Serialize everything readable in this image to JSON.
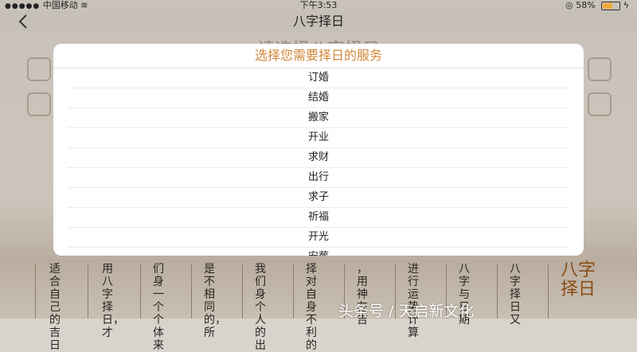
{
  "status_bar": {
    "carrier": "中国移动",
    "time": "下午3:53",
    "battery": "58%",
    "battery_level": 0.58
  },
  "nav": {
    "title": "八字择日"
  },
  "background": {
    "heading": "请选择八字择日",
    "columns": [
      "适合自己的吉日",
      "用八字择日，才",
      "们身一个个体来",
      "是不相同的，所",
      "我们身个人的出",
      "择对自身不利的",
      "，用神在吉",
      "进行运势计算",
      "八字与日期",
      "八字择日又"
    ],
    "badge": "八字择日"
  },
  "dialog": {
    "title": "选择您需要择日的服务",
    "options": [
      "订婚",
      "结婚",
      "搬家",
      "开业",
      "求财",
      "出行",
      "求子",
      "祈福",
      "开光",
      "安葬"
    ]
  },
  "watermark": "头条号 / 天启新文化",
  "colors": {
    "accent": "#d2883a",
    "overlay": "#c9c2b9"
  }
}
